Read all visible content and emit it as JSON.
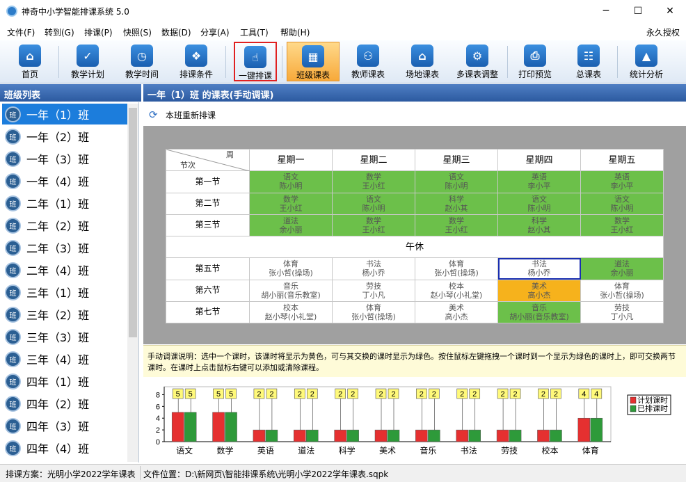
{
  "app": {
    "title": "神奇中小学智能排课系统 5.0",
    "license": "永久授权"
  },
  "menu": [
    "文件(F)",
    "转到(G)",
    "排课(P)",
    "快照(S)",
    "数据(D)",
    "分享(A)",
    "工具(T)",
    "帮助(H)"
  ],
  "toolbar": [
    {
      "label": "首页",
      "icon": "home-icon"
    },
    {
      "label": "教学计划",
      "icon": "clipboard-icon"
    },
    {
      "label": "教学时间",
      "icon": "clock-icon"
    },
    {
      "label": "排课条件",
      "icon": "cubes-icon"
    },
    {
      "label": "一键排课",
      "icon": "hand-pointer-icon"
    },
    {
      "label": "班级课表",
      "icon": "grid-icon"
    },
    {
      "label": "教师课表",
      "icon": "teacher-icon"
    },
    {
      "label": "场地课表",
      "icon": "building-icon"
    },
    {
      "label": "多课表调整",
      "icon": "adjust-icon"
    },
    {
      "label": "打印预览",
      "icon": "printer-icon"
    },
    {
      "label": "总课表",
      "icon": "calendar-icon"
    },
    {
      "label": "统计分析",
      "icon": "stats-icon"
    }
  ],
  "left": {
    "title": "班级列表",
    "icon_text": "班",
    "classes": [
      "一年（1）班",
      "一年（2）班",
      "一年（3）班",
      "一年（4）班",
      "二年（1）班",
      "二年（2）班",
      "二年（3）班",
      "二年（4）班",
      "三年（1）班",
      "三年（2）班",
      "三年（3）班",
      "三年（4）班",
      "四年（1）班",
      "四年（2）班",
      "四年（3）班",
      "四年（4）班"
    ]
  },
  "right": {
    "title": "一年（1）班 的课表(手动调课)",
    "rearrange": "本班重新排课"
  },
  "timetable": {
    "corner_top": "周",
    "corner_bottom": "节次",
    "days": [
      "星期一",
      "星期二",
      "星期三",
      "星期四",
      "星期五"
    ],
    "lunch": "午休",
    "periods": [
      {
        "name": "第一节",
        "cells": [
          {
            "s": "语文",
            "t": "陈小明",
            "c": "green"
          },
          {
            "s": "数学",
            "t": "王小红",
            "c": "green"
          },
          {
            "s": "语文",
            "t": "陈小明",
            "c": "green"
          },
          {
            "s": "英语",
            "t": "李小平",
            "c": "green"
          },
          {
            "s": "英语",
            "t": "李小平",
            "c": "green"
          }
        ]
      },
      {
        "name": "第二节",
        "cells": [
          {
            "s": "数学",
            "t": "王小红",
            "c": "green"
          },
          {
            "s": "语文",
            "t": "陈小明",
            "c": "green"
          },
          {
            "s": "科学",
            "t": "赵小其",
            "c": "green"
          },
          {
            "s": "语文",
            "t": "陈小明",
            "c": "green"
          },
          {
            "s": "语文",
            "t": "陈小明",
            "c": "green"
          }
        ]
      },
      {
        "name": "第三节",
        "cells": [
          {
            "s": "道法",
            "t": "余小丽",
            "c": "green"
          },
          {
            "s": "数学",
            "t": "王小红",
            "c": "green"
          },
          {
            "s": "数学",
            "t": "王小红",
            "c": "green"
          },
          {
            "s": "科学",
            "t": "赵小其",
            "c": "green"
          },
          {
            "s": "数学",
            "t": "王小红",
            "c": "green"
          }
        ]
      },
      {
        "name": "第五节",
        "cells": [
          {
            "s": "体育",
            "t": "张小哲(操场)",
            "c": ""
          },
          {
            "s": "书法",
            "t": "杨小乔",
            "c": ""
          },
          {
            "s": "体育",
            "t": "张小哲(操场)",
            "c": ""
          },
          {
            "s": "书法",
            "t": "杨小乔",
            "c": "selected"
          },
          {
            "s": "道法",
            "t": "余小丽",
            "c": "green"
          }
        ]
      },
      {
        "name": "第六节",
        "cells": [
          {
            "s": "音乐",
            "t": "胡小丽(音乐教室)",
            "c": ""
          },
          {
            "s": "劳技",
            "t": "丁小凡",
            "c": ""
          },
          {
            "s": "校本",
            "t": "赵小琴(小礼堂)",
            "c": ""
          },
          {
            "s": "美术",
            "t": "高小杰",
            "c": "orange"
          },
          {
            "s": "体育",
            "t": "张小哲(操场)",
            "c": ""
          }
        ]
      },
      {
        "name": "第七节",
        "cells": [
          {
            "s": "校本",
            "t": "赵小琴(小礼堂)",
            "c": ""
          },
          {
            "s": "体育",
            "t": "张小哲(操场)",
            "c": ""
          },
          {
            "s": "美术",
            "t": "高小杰",
            "c": ""
          },
          {
            "s": "音乐",
            "t": "胡小丽(音乐教室)",
            "c": "green"
          },
          {
            "s": "劳技",
            "t": "丁小凡",
            "c": ""
          }
        ]
      }
    ]
  },
  "note": "手动调课说明：选中一个课时，该课时将显示为黄色，可与其交换的课时显示为绿色。按住鼠标左键拖拽一个课时到一个显示为绿色的课时上，即可交换两节课时。在课时上点击鼠标右键可以添加或清除课程。",
  "chart_data": {
    "type": "bar",
    "categories": [
      "语文",
      "数学",
      "英语",
      "道法",
      "科学",
      "美术",
      "音乐",
      "书法",
      "劳技",
      "校本",
      "体育"
    ],
    "series": [
      {
        "name": "计划课时",
        "values": [
          5,
          5,
          2,
          2,
          2,
          2,
          2,
          2,
          2,
          2,
          4
        ],
        "color": "#e53030"
      },
      {
        "name": "已排课时",
        "values": [
          5,
          5,
          2,
          2,
          2,
          2,
          2,
          2,
          2,
          2,
          4
        ],
        "color": "#2e9a3a"
      }
    ],
    "yticks": [
      0,
      2,
      4,
      6,
      8
    ],
    "ylim": [
      0,
      9
    ],
    "legend": "top-right",
    "grid": false
  },
  "status": {
    "plan": "排课方案：光明小学2022学年课表",
    "path": "文件位置：D:\\新网页\\智能排课系统\\光明小学2022学年课表.sqpk"
  }
}
